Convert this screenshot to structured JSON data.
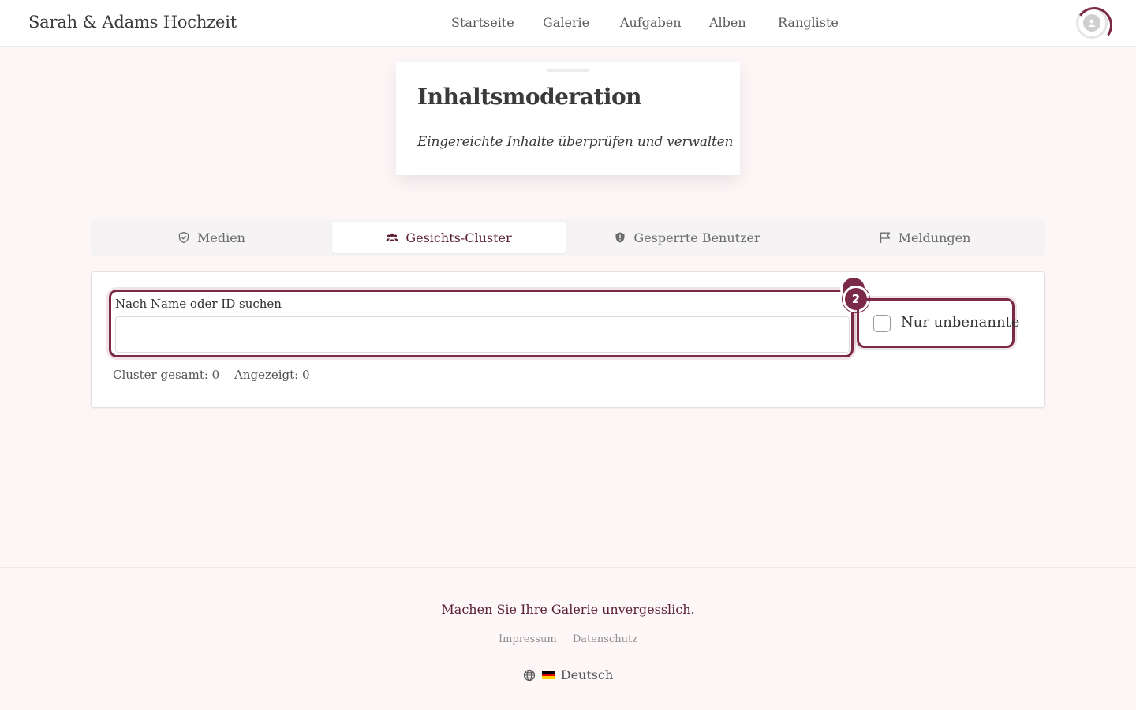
{
  "header": {
    "brand": "Sarah & Adams Hochzeit",
    "nav": [
      "Startseite",
      "Galerie",
      "Aufgaben",
      "Alben",
      "Rangliste"
    ]
  },
  "hero": {
    "title": "Inhaltsmoderation",
    "subtitle": "Eingereichte Inhalte überprüfen und verwalten"
  },
  "tabs": [
    {
      "label": "Medien",
      "icon": "shield-check-icon",
      "active": false
    },
    {
      "label": "Gesichts-Cluster",
      "icon": "users-icon",
      "active": true
    },
    {
      "label": "Gesperrte Benutzer",
      "icon": "shield-alert-icon",
      "active": false
    },
    {
      "label": "Meldungen",
      "icon": "flag-icon",
      "active": false
    }
  ],
  "clusters": {
    "search_label": "Nach Name oder ID suchen",
    "search_value": "",
    "badge": "2",
    "checkbox_label": "Nur unbenannte",
    "checkbox_checked": false,
    "stat_total": "Cluster gesamt: 0",
    "stat_shown": "Angezeigt: 0"
  },
  "footer": {
    "tagline": "Machen Sie Ihre Galerie unvergesslich.",
    "links": [
      "Impressum",
      "Datenschutz"
    ],
    "language": "Deutsch"
  },
  "colors": {
    "accent": "#7a2a48",
    "background": "#fdf6f7"
  }
}
